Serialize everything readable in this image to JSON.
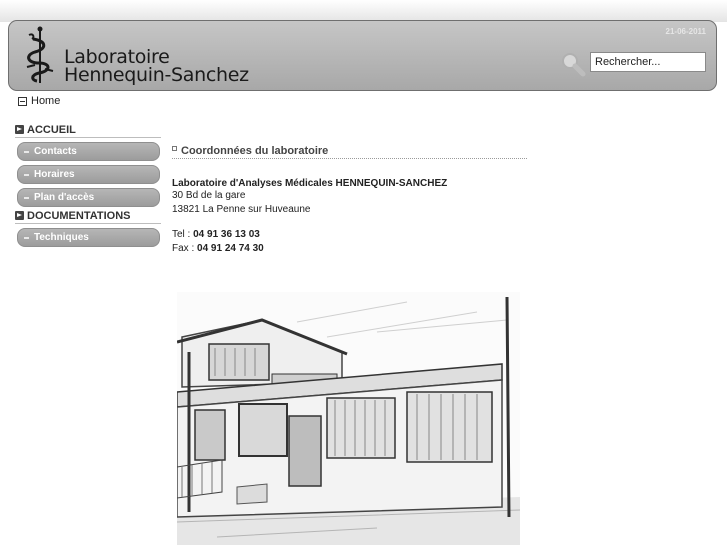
{
  "header": {
    "logo_line1": "Laboratoire",
    "logo_line2": "Hennequin-Sanchez",
    "date": "21-06-2011",
    "search_value": "Rechercher...",
    "icons": {
      "logo": "caduceus-logo",
      "search": "magnifier-icon"
    }
  },
  "breadcrumb": {
    "home": "Home",
    "icon": "home-icon"
  },
  "sidebar": {
    "sections": [
      {
        "title": "ACCUEIL",
        "items": [
          "Contacts",
          "Horaires",
          "Plan d'accès"
        ]
      },
      {
        "title": "DOCUMENTATIONS",
        "items": [
          "Techniques"
        ]
      }
    ]
  },
  "content": {
    "title": "Coordonnées du laboratoire",
    "lab_name": "Laboratoire d'Analyses Médicales HENNEQUIN-SANCHEZ",
    "address1": "30 Bd de la gare",
    "address2": "13821 La Penne sur Huveaune",
    "tel_label": "Tel : ",
    "tel_value": "04 91 36 13 03",
    "fax_label": "Fax : ",
    "fax_value": "04 91  24 74 30"
  },
  "colors": {
    "header_bg": "#b4b4b4",
    "nav_bg": "#a8a8a8",
    "nav_text": "#ffffff"
  }
}
